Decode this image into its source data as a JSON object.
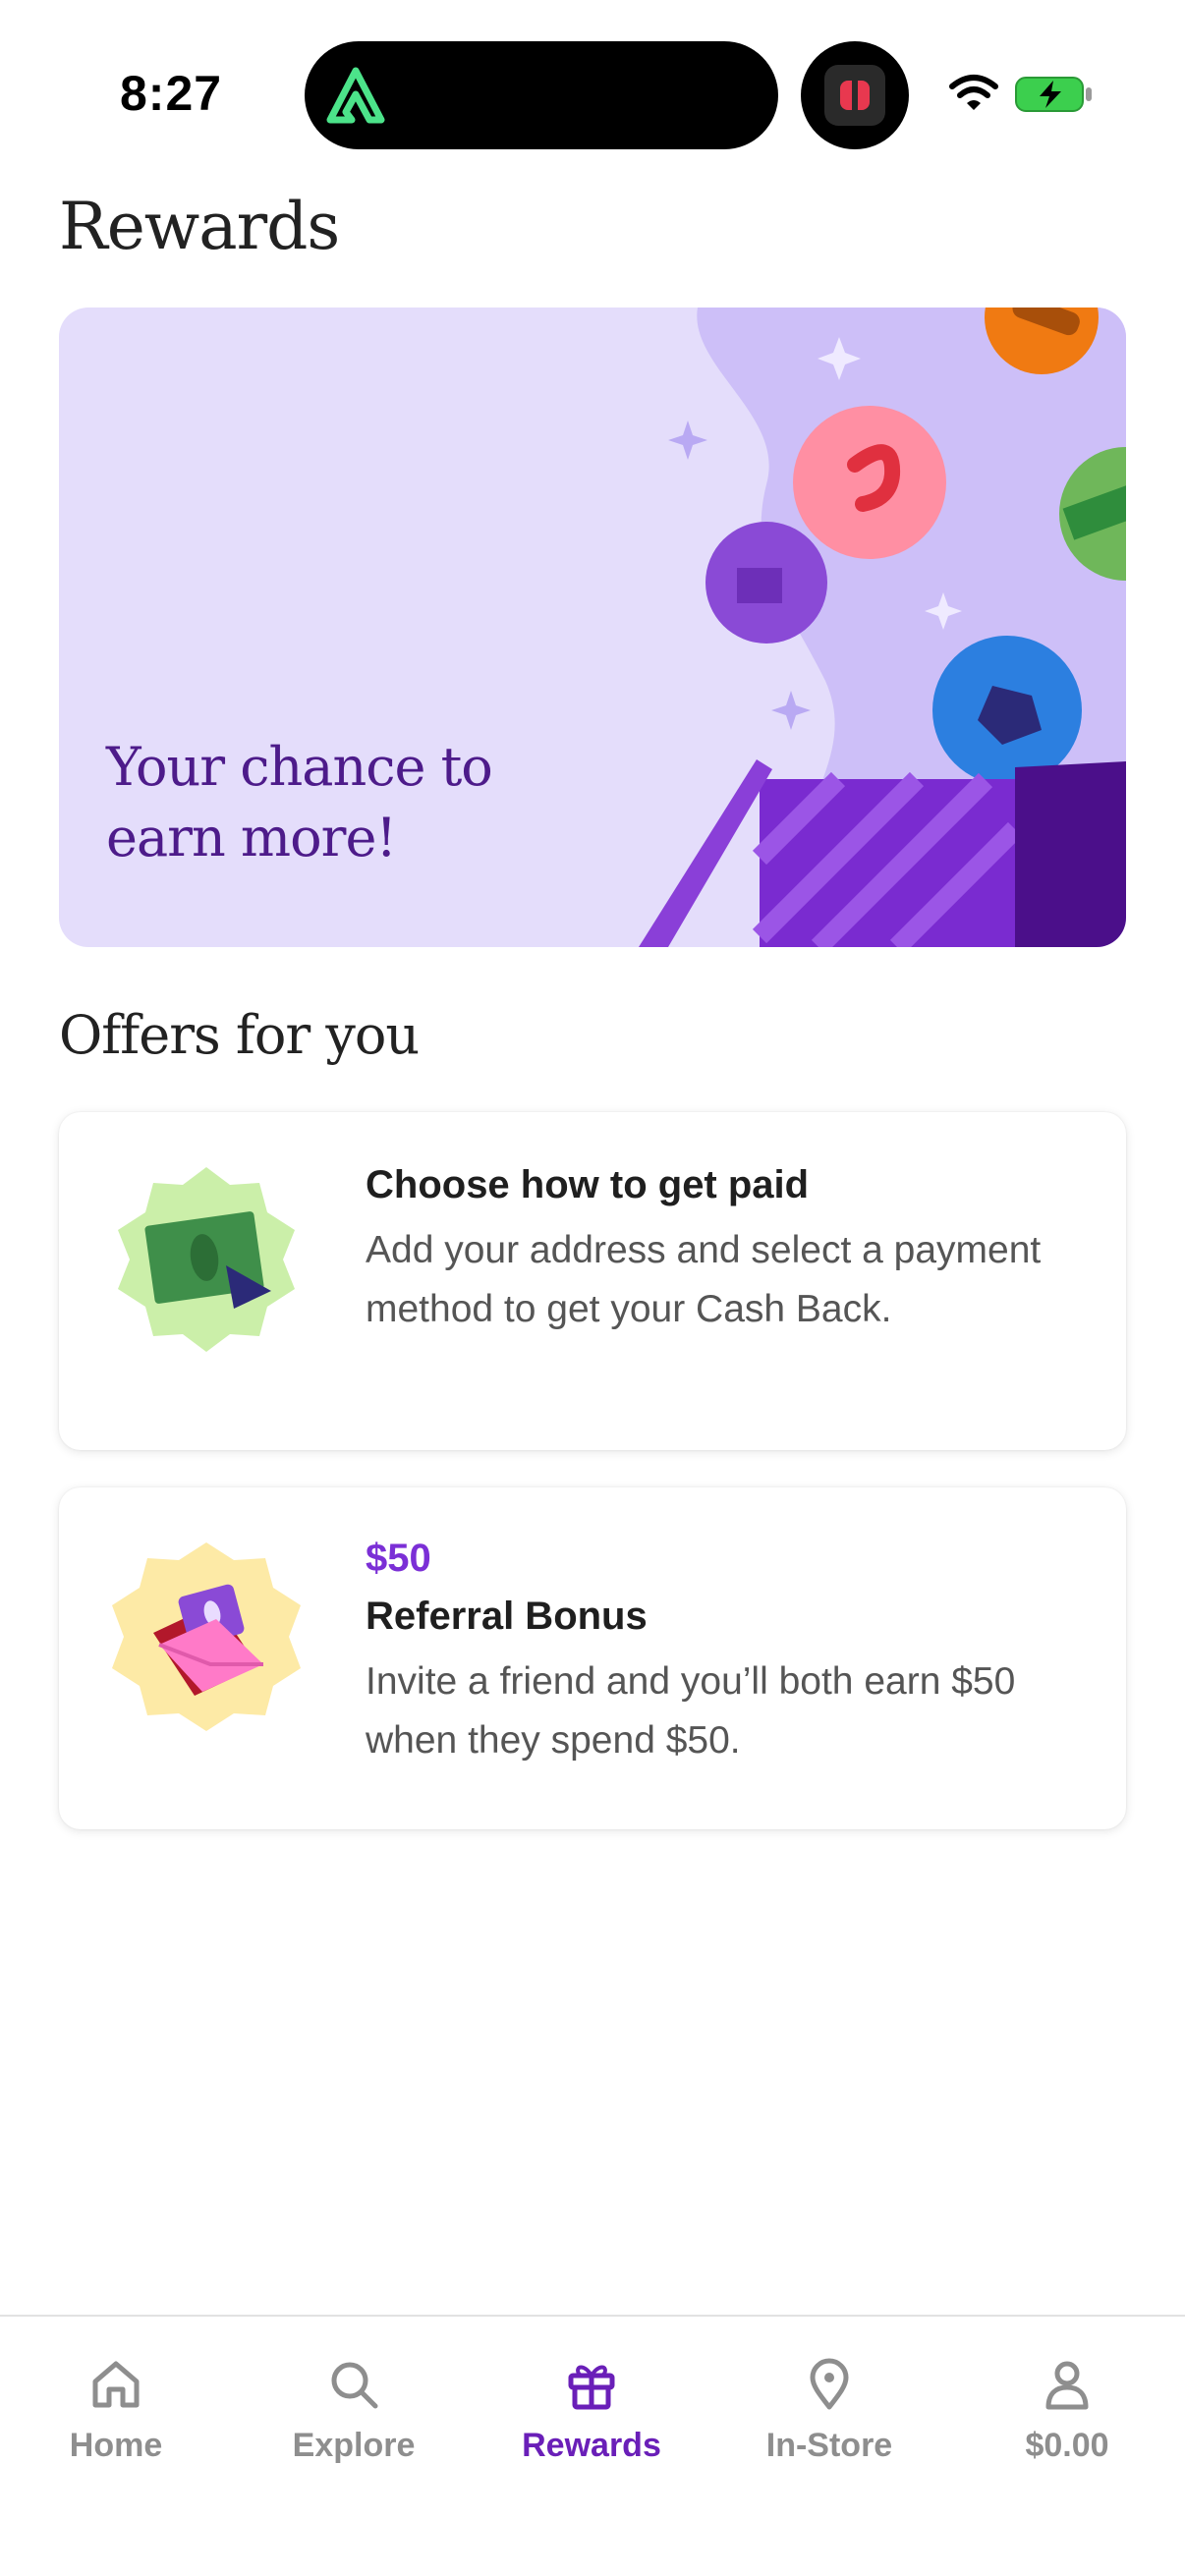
{
  "status_bar": {
    "time": "8:27"
  },
  "header": {
    "title": "Rewards"
  },
  "hero": {
    "line1": "Your chance to",
    "line2": "earn more!"
  },
  "offers": {
    "section_title": "Offers for you",
    "items": [
      {
        "title": "Choose how to get paid",
        "description": "Add your address and select a payment method to get your Cash Back.",
        "icon": "cash-icon"
      },
      {
        "amount": "$50",
        "title": "Referral Bonus",
        "description": "Invite a friend and you’ll both earn $50 when they spend $50.",
        "icon": "envelope-icon"
      }
    ]
  },
  "nav": {
    "items": [
      {
        "label": "Home",
        "icon": "home-icon"
      },
      {
        "label": "Explore",
        "icon": "search-icon"
      },
      {
        "label": "Rewards",
        "icon": "gift-icon",
        "active": true
      },
      {
        "label": "In-Store",
        "icon": "location-pin-icon"
      },
      {
        "label": "$0.00",
        "icon": "person-icon"
      }
    ]
  },
  "colors": {
    "accent": "#6a1fb8",
    "amount": "#7b2fd6",
    "hero_bg": "#e4ddfb",
    "hero_text": "#4d1b8a"
  }
}
